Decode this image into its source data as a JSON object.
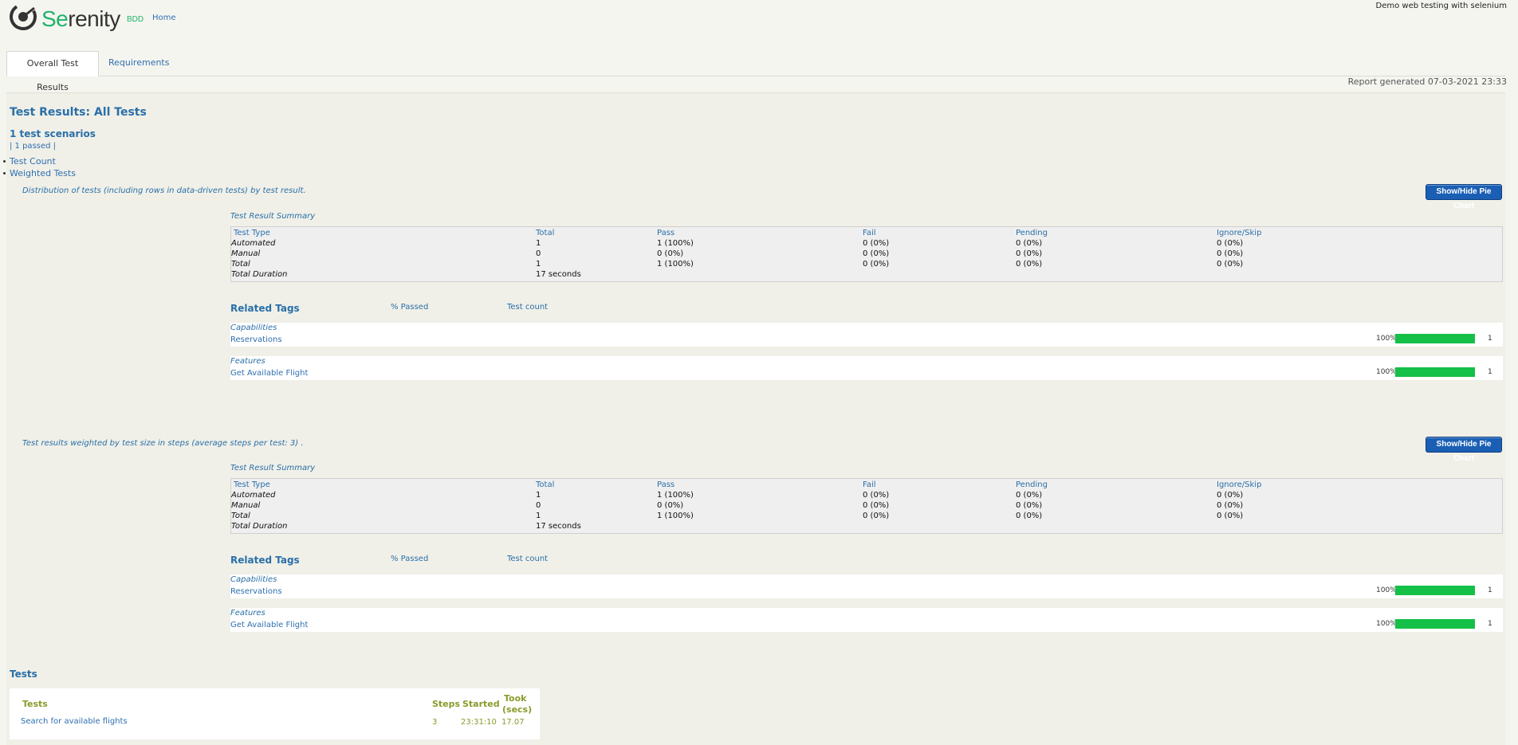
{
  "header": {
    "brand_prefix": "Se",
    "brand_rest": "renity",
    "brand_suffix": "BDD",
    "nav_home": "Home",
    "project_title": "Demo web testing with selenium"
  },
  "tabs": [
    {
      "label": "Overall Test Results"
    },
    {
      "label": "Requirements"
    }
  ],
  "report_generated": "Report generated 07-03-2021 23:33",
  "summary": {
    "title": "Test Results: All Tests",
    "scenarios": "1 test scenarios",
    "passed": "| 1 passed |",
    "links": [
      "Test Count",
      "Weighted Tests"
    ]
  },
  "sections": [
    {
      "description": "Distribution of tests (including rows in data-driven tests) by test result.",
      "button": "Show/Hide Pie Chart",
      "summary_title": "Test Result Summary",
      "headers": [
        "Test Type",
        "Total",
        "Pass",
        "Fail",
        "Pending",
        "Ignore/Skip"
      ],
      "rows": [
        [
          "Automated",
          "1",
          "1 (100%)",
          "0 (0%)",
          "0 (0%)",
          "0 (0%)"
        ],
        [
          "Manual",
          "0",
          "0 (0%)",
          "0 (0%)",
          "0 (0%)",
          "0 (0%)"
        ],
        [
          "Total",
          "1",
          "1 (100%)",
          "0 (0%)",
          "0 (0%)",
          "0 (0%)"
        ]
      ],
      "duration_label": "Total Duration",
      "duration_value": "17 seconds",
      "tags_title": "Related Tags",
      "tags_passed_col": "% Passed",
      "tags_count_col": "Test count",
      "tags": [
        {
          "category": "Capabilities",
          "name": "Reservations",
          "pct": "100%",
          "pass_fraction": 1.0,
          "count": "1"
        },
        {
          "category": "Features",
          "name": "Get Available Flight",
          "pct": "100%",
          "pass_fraction": 1.0,
          "count": "1"
        }
      ]
    },
    {
      "description": "Test results weighted by test size in steps (average steps per test: 3) .",
      "button": "Show/Hide Pie Chart",
      "summary_title": "Test Result Summary",
      "headers": [
        "Test Type",
        "Total",
        "Pass",
        "Fail",
        "Pending",
        "Ignore/Skip"
      ],
      "rows": [
        [
          "Automated",
          "1",
          "1 (100%)",
          "0 (0%)",
          "0 (0%)",
          "0 (0%)"
        ],
        [
          "Manual",
          "0",
          "0 (0%)",
          "0 (0%)",
          "0 (0%)",
          "0 (0%)"
        ],
        [
          "Total",
          "1",
          "1 (100%)",
          "0 (0%)",
          "0 (0%)",
          "0 (0%)"
        ]
      ],
      "duration_label": "Total Duration",
      "duration_value": "17 seconds",
      "tags_title": "Related Tags",
      "tags_passed_col": "% Passed",
      "tags_count_col": "Test count",
      "tags": [
        {
          "category": "Capabilities",
          "name": "Reservations",
          "pct": "100%",
          "pass_fraction": 1.0,
          "count": "1"
        },
        {
          "category": "Features",
          "name": "Get Available Flight",
          "pct": "100%",
          "pass_fraction": 1.0,
          "count": "1"
        }
      ]
    }
  ],
  "tests": {
    "title": "Tests",
    "headers": {
      "tests": "Tests",
      "steps": "Steps",
      "started": "Started",
      "took_1": "Took",
      "took_2": "(secs)"
    },
    "rows": [
      {
        "name": "Search for available flights",
        "steps": "3",
        "started": "23:31:10",
        "took": "17.07"
      }
    ]
  },
  "colors": {
    "brand": "#1fb36a",
    "link": "#2f6fb0",
    "bar_pass": "#14c047",
    "button": "#1a5fb4"
  }
}
